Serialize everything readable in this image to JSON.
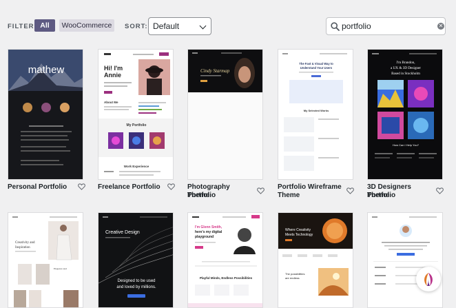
{
  "toolbar": {
    "filter_label": "FILTER:",
    "filter_all": "All",
    "filter_woo": "WooCommerce",
    "sort_label": "SORT:",
    "sort_value": "Default",
    "search_value": "portfolio"
  },
  "themes": [
    {
      "title_line1": "Personal Portfolio",
      "title_line2": "",
      "preview_text": "mathew"
    },
    {
      "title_line1": "Freelance Portfolio",
      "title_line2": "",
      "preview_text": "Hi! I'm Annie"
    },
    {
      "title_line1": "Photography Portfolio",
      "title_line2": "Theme",
      "preview_text": "Cindy Starmap"
    },
    {
      "title_line1": "Portfolio Wireframe",
      "title_line2": "Theme",
      "preview_text": "The Fast & Visual Way to Understand Your Users"
    },
    {
      "title_line1": "3D Designers Portfolio",
      "title_line2": "Theme",
      "preview_text": "I'm Brandon, a UX & 3D Designer Based in Stockholm"
    },
    {
      "title_line1": "",
      "title_line2": "",
      "preview_text": "Creativity and Inspiration"
    },
    {
      "title_line1": "",
      "title_line2": "",
      "preview_text": "Creative Design"
    },
    {
      "title_line1": "",
      "title_line2": "",
      "preview_text": "I'm Glenn Smith, here's my digital playground"
    },
    {
      "title_line1": "",
      "title_line2": "",
      "preview_text": "Where Creativity Meets Technology"
    },
    {
      "title_line1": "",
      "title_line2": "",
      "preview_text": "Hey there, I'm a passionate designer"
    }
  ],
  "previews": {
    "p2_portfolio": "My Portfolio",
    "p2_about": "About Me",
    "p2_work": "Work Experience",
    "p4_works": "My Selected Works",
    "p5_help": "How Can I Help You?",
    "p7_sub": "Designed to be used and loved by millions.",
    "p8_sub": "Playful Minds, Endless Possibilities",
    "p9_sub": "The possibilities are endless"
  },
  "colors": {
    "accent": "#5e5a82",
    "accent_light": "#dcdae2",
    "background": "#f0f0f1"
  }
}
